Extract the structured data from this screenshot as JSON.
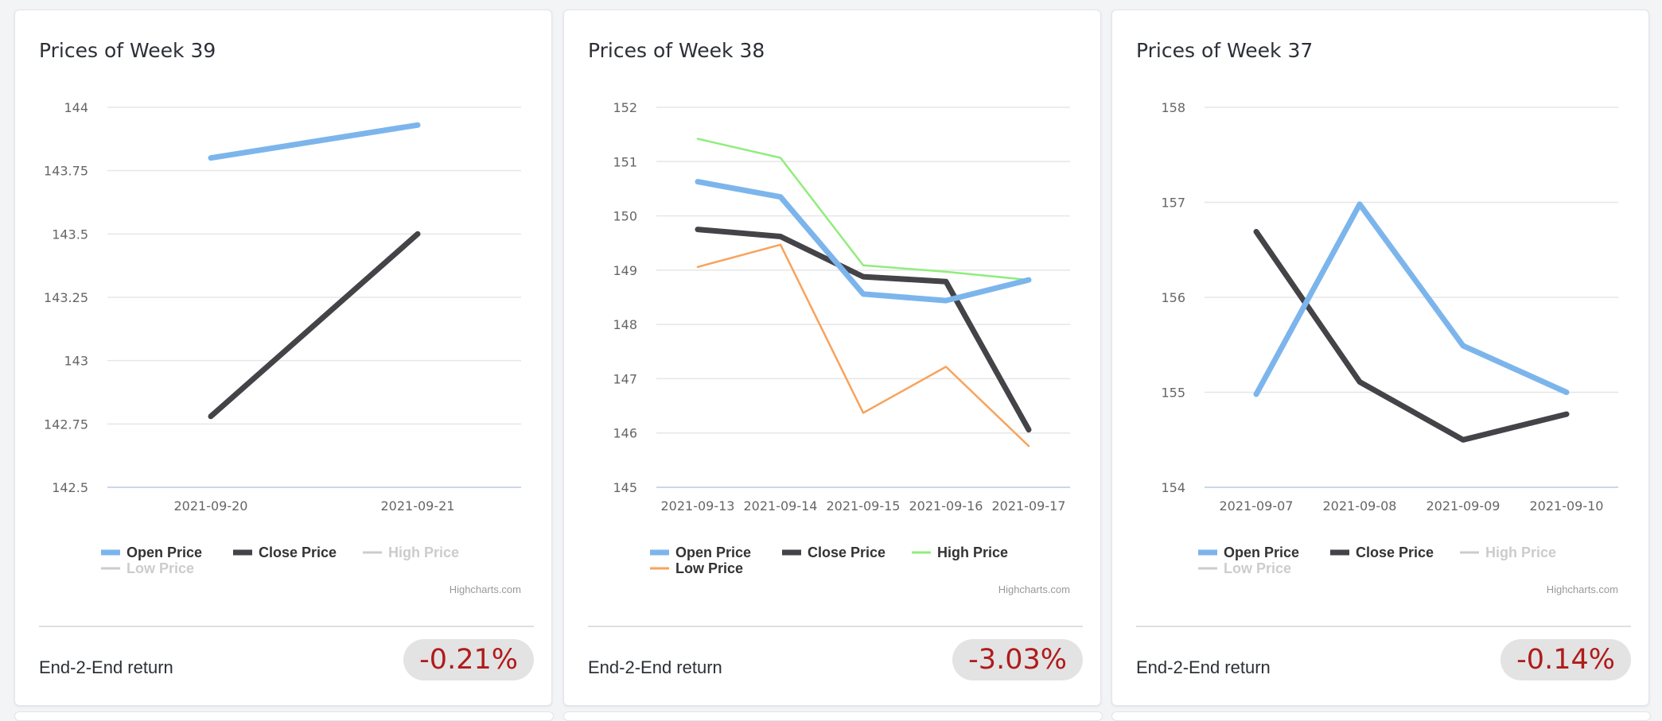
{
  "colors": {
    "open": "#7cb5ec",
    "close": "#434348",
    "high": "#90ed7d",
    "low": "#f7a35c",
    "hidden": "#cccccc",
    "grid": "#e6e6e6",
    "axis_text": "#666666",
    "return_negative": "#b01b1b"
  },
  "cards": [
    {
      "title": "Prices of Week 39",
      "return_label": "End-2-End return",
      "return_value": "-0.21%",
      "credits": "Highcharts.com"
    },
    {
      "title": "Prices of Week 38",
      "return_label": "End-2-End return",
      "return_value": "-3.03%",
      "credits": "Highcharts.com"
    },
    {
      "title": "Prices of Week 37",
      "return_label": "End-2-End return",
      "return_value": "-0.14%",
      "credits": "Highcharts.com"
    }
  ],
  "chart_data": [
    {
      "type": "line",
      "title": "Prices of Week 39",
      "categories": [
        "2021-09-20",
        "2021-09-21"
      ],
      "ylim": [
        142.5,
        144
      ],
      "yticks": [
        142.5,
        142.75,
        143,
        143.25,
        143.5,
        143.75,
        144
      ],
      "ytick_labels": [
        "142.5",
        "142.75",
        "143",
        "143.25",
        "143.5",
        "143.75",
        "144"
      ],
      "grid": true,
      "legend_position": "bottom-left",
      "series": [
        {
          "name": "Open Price",
          "key": "open",
          "visible": true,
          "values": [
            143.8,
            143.93
          ]
        },
        {
          "name": "Close Price",
          "key": "close",
          "visible": true,
          "values": [
            142.78,
            143.5
          ]
        },
        {
          "name": "High Price",
          "key": "high",
          "visible": false,
          "values": []
        },
        {
          "name": "Low Price",
          "key": "low",
          "visible": false,
          "values": []
        }
      ]
    },
    {
      "type": "line",
      "title": "Prices of Week 38",
      "categories": [
        "2021-09-13",
        "2021-09-14",
        "2021-09-15",
        "2021-09-16",
        "2021-09-17"
      ],
      "ylim": [
        145,
        152
      ],
      "yticks": [
        145,
        146,
        147,
        148,
        149,
        150,
        151,
        152
      ],
      "ytick_labels": [
        "145",
        "146",
        "147",
        "148",
        "149",
        "150",
        "151",
        "152"
      ],
      "grid": true,
      "legend_position": "bottom-left",
      "series": [
        {
          "name": "Open Price",
          "key": "open",
          "visible": true,
          "values": [
            150.63,
            150.35,
            148.56,
            148.44,
            148.82
          ]
        },
        {
          "name": "Close Price",
          "key": "close",
          "visible": true,
          "values": [
            149.75,
            149.62,
            148.88,
            148.79,
            146.06
          ]
        },
        {
          "name": "High Price",
          "key": "high",
          "visible": true,
          "values": [
            151.42,
            151.07,
            149.09,
            148.97,
            148.82
          ]
        },
        {
          "name": "Low Price",
          "key": "low",
          "visible": true,
          "values": [
            149.06,
            149.47,
            146.37,
            147.22,
            145.76
          ]
        }
      ]
    },
    {
      "type": "line",
      "title": "Prices of Week 37",
      "categories": [
        "2021-09-07",
        "2021-09-08",
        "2021-09-09",
        "2021-09-10"
      ],
      "ylim": [
        154,
        158
      ],
      "yticks": [
        154,
        155,
        156,
        157,
        158
      ],
      "ytick_labels": [
        "154",
        "155",
        "156",
        "157",
        "158"
      ],
      "grid": true,
      "legend_position": "bottom-left",
      "series": [
        {
          "name": "Open Price",
          "key": "open",
          "visible": true,
          "values": [
            154.98,
            156.98,
            155.49,
            155.0
          ]
        },
        {
          "name": "Close Price",
          "key": "close",
          "visible": true,
          "values": [
            156.69,
            155.11,
            154.5,
            154.77
          ]
        },
        {
          "name": "High Price",
          "key": "high",
          "visible": false,
          "values": []
        },
        {
          "name": "Low Price",
          "key": "low",
          "visible": false,
          "values": []
        }
      ]
    }
  ]
}
